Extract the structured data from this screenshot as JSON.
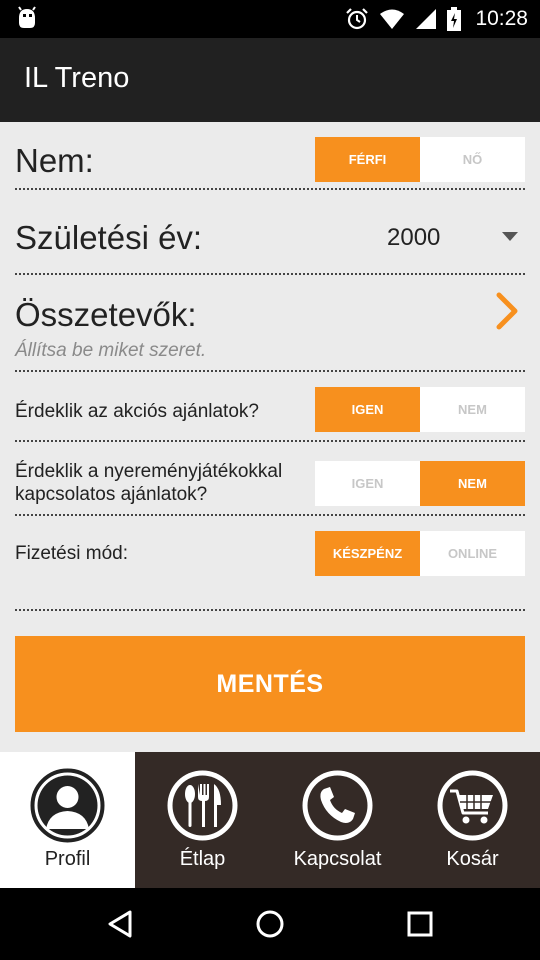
{
  "status": {
    "time": "10:28"
  },
  "app": {
    "title": "IL Treno"
  },
  "form": {
    "gender": {
      "label": "Nem:",
      "options": [
        "FÉRFI",
        "NŐ"
      ],
      "selected": 0
    },
    "birth_year": {
      "label": "Születési év:",
      "value": "2000"
    },
    "ingredients": {
      "label": "Összetevők:",
      "hint": "Állítsa be miket szeret."
    },
    "promo": {
      "label": "Érdeklik az akciós ajánlatok?",
      "options": [
        "IGEN",
        "NEM"
      ],
      "selected": 0
    },
    "lottery": {
      "label_line1": "Érdeklik a nyereményjátékokkal",
      "label_line2": "kapcsolatos ajánlatok?",
      "options": [
        "IGEN",
        "NEM"
      ],
      "selected": 1
    },
    "payment": {
      "label": "Fizetési mód:",
      "options": [
        "KÉSZPÉNZ",
        "ONLINE"
      ],
      "selected": 0
    },
    "save_label": "MENTÉS"
  },
  "tabs": [
    {
      "label": "Profil",
      "icon": "profile-icon",
      "active": true
    },
    {
      "label": "Étlap",
      "icon": "menu-cutlery-icon",
      "active": false
    },
    {
      "label": "Kapcsolat",
      "icon": "phone-icon",
      "active": false
    },
    {
      "label": "Kosár",
      "icon": "cart-icon",
      "active": false
    }
  ],
  "colors": {
    "accent": "#f7901e",
    "appbar": "#212121",
    "tabbar": "#342a26",
    "background": "#ebebeb"
  }
}
